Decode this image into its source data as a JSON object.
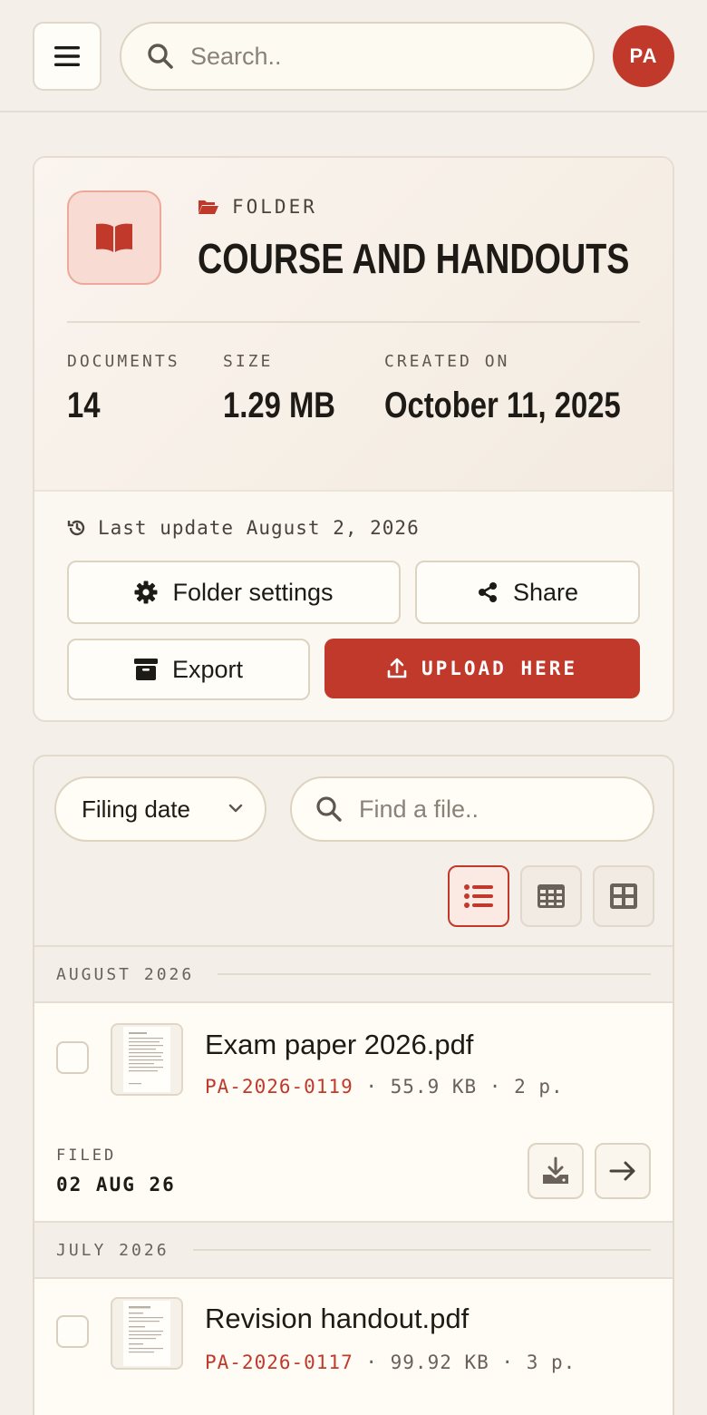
{
  "search": {
    "placeholder": "Search.."
  },
  "user": {
    "initials": "PA"
  },
  "folder": {
    "label": "FOLDER",
    "title": "COURSE AND HANDOUTS",
    "stats": [
      {
        "label": "DOCUMENTS",
        "value": "14"
      },
      {
        "label": "SIZE",
        "value": "1.29 MB"
      },
      {
        "label": "CREATED ON",
        "value": "October 11, 2025"
      }
    ],
    "last_update": "Last update August 2, 2026",
    "actions": {
      "settings": "Folder settings",
      "share": "Share",
      "export": "Export",
      "upload": "UPLOAD HERE"
    }
  },
  "files": {
    "sort": "Filing date",
    "find_placeholder": "Find a file..",
    "groups": [
      {
        "label": "AUGUST 2026",
        "items": [
          {
            "name": "Exam paper 2026.pdf",
            "ref": "PA-2026-0119",
            "meta": " · 55.9 KB · 2 p.",
            "filed_label": "FILED",
            "filed_date": "02 AUG 26"
          }
        ]
      },
      {
        "label": "JULY 2026",
        "items": [
          {
            "name": "Revision handout.pdf",
            "ref": "PA-2026-0117",
            "meta": " · 99.92 KB · 3 p."
          }
        ]
      }
    ]
  },
  "colors": {
    "accent": "#c0392b",
    "background": "#f4efe9"
  }
}
